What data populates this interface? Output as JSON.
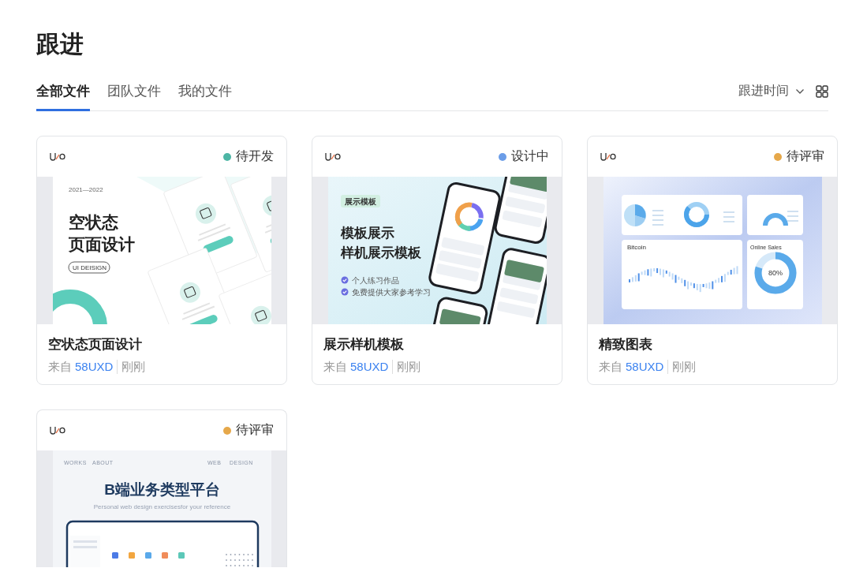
{
  "page": {
    "title": "跟进"
  },
  "tabs": [
    {
      "label": "全部文件",
      "selected": true
    },
    {
      "label": "团队文件",
      "selected": false
    },
    {
      "label": "我的文件",
      "selected": false
    }
  ],
  "sort": {
    "label": "跟进时间"
  },
  "cards": [
    {
      "status": {
        "label": "待开发",
        "color": "#4db6a5"
      },
      "preview": {
        "kind": "empty-state",
        "date": "2021—2022",
        "heading": [
          "空状态",
          "页面设计"
        ],
        "tag": "UI DEISIGN"
      },
      "title": "空状态页面设计",
      "source_prefix": "来自",
      "source": "58UXD",
      "time": "刚刚"
    },
    {
      "status": {
        "label": "设计中",
        "color": "#6b9de8"
      },
      "preview": {
        "kind": "mockup",
        "tag": "展示模板",
        "heading": [
          "模板展示",
          "样机展示模板"
        ],
        "bullets": [
          "个人练习作品",
          "免费提供大家参考学习"
        ]
      },
      "title": "展示样机模板",
      "source_prefix": "来自",
      "source": "58UXD",
      "time": "刚刚"
    },
    {
      "status": {
        "label": "待评审",
        "color": "#e6a84a"
      },
      "preview": {
        "kind": "dashboard",
        "panels": [
          "Bitcoin",
          "Online Sales"
        ],
        "reading": "80%"
      },
      "title": "精致图表",
      "source_prefix": "来自",
      "source": "58UXD",
      "time": "刚刚"
    },
    {
      "status": {
        "label": "待评审",
        "color": "#e6a84a"
      },
      "preview": {
        "kind": "web",
        "nav": [
          "WORKS",
          "ABOUT",
          "WEB",
          "DESIGN"
        ],
        "heading": [
          "B端业务类型平台"
        ],
        "subtitle": "Personal web design exercisesfor your reference"
      }
    }
  ]
}
